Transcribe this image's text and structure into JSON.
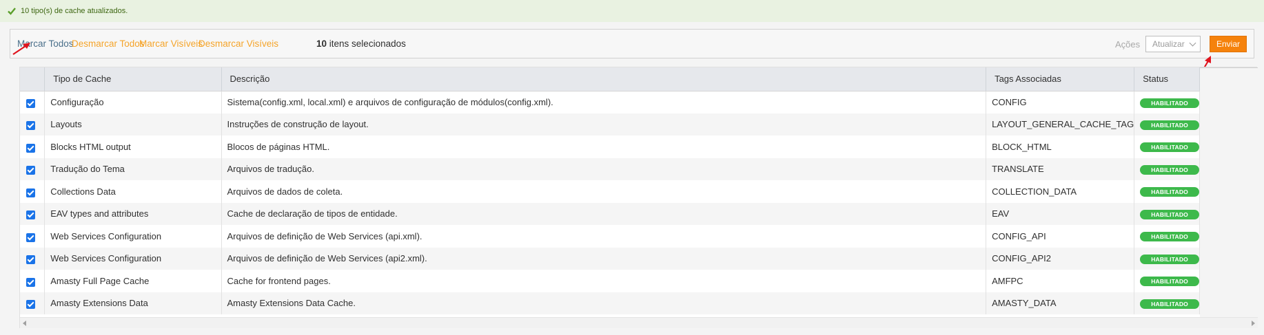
{
  "messages": {
    "success_text": "10 tipo(s) de cache atualizados."
  },
  "massaction": {
    "select_all": "Marcar Todos",
    "unselect_all": "Desmarcar Todos",
    "select_visible": "Marcar Visíveis",
    "unselect_visible": "Desmarcar Visíveis",
    "selected_count": "10",
    "selected_suffix": " itens selecionados",
    "actions_label": "Ações",
    "actions_select_value": "Atualizar",
    "submit_label": "Enviar"
  },
  "colors": {
    "link_blue": "#4a6f8a",
    "link_orange": "#f5a42a",
    "submit_orange": "#f5820c",
    "badge_green": "#3db94b",
    "arrow_red": "#e0141e"
  },
  "grid": {
    "headers": {
      "type": "Tipo de Cache",
      "description": "Descrição",
      "tags": "Tags Associadas",
      "status": "Status"
    },
    "rows": [
      {
        "type": "Configuração",
        "description": "Sistema(config.xml, local.xml) e arquivos de configuração de módulos(config.xml).",
        "tags": "CONFIG",
        "status": "HABILITADO"
      },
      {
        "type": "Layouts",
        "description": "Instruções de construção de layout.",
        "tags": "LAYOUT_GENERAL_CACHE_TAG",
        "status": "HABILITADO"
      },
      {
        "type": "Blocks HTML output",
        "description": "Blocos de páginas HTML.",
        "tags": "BLOCK_HTML",
        "status": "HABILITADO"
      },
      {
        "type": "Tradução do Tema",
        "description": "Arquivos de tradução.",
        "tags": "TRANSLATE",
        "status": "HABILITADO"
      },
      {
        "type": "Collections Data",
        "description": "Arquivos de dados de coleta.",
        "tags": "COLLECTION_DATA",
        "status": "HABILITADO"
      },
      {
        "type": "EAV types and attributes",
        "description": "Cache de declaração de tipos de entidade.",
        "tags": "EAV",
        "status": "HABILITADO"
      },
      {
        "type": "Web Services Configuration",
        "description": "Arquivos de definição de Web Services (api.xml).",
        "tags": "CONFIG_API",
        "status": "HABILITADO"
      },
      {
        "type": "Web Services Configuration",
        "description": "Arquivos de definição de Web Services (api2.xml).",
        "tags": "CONFIG_API2",
        "status": "HABILITADO"
      },
      {
        "type": "Amasty Full Page Cache",
        "description": "Cache for frontend pages.",
        "tags": "AMFPC",
        "status": "HABILITADO"
      },
      {
        "type": "Amasty Extensions Data",
        "description": "Amasty Extensions Data Cache.",
        "tags": "AMASTY_DATA",
        "status": "HABILITADO"
      }
    ]
  }
}
